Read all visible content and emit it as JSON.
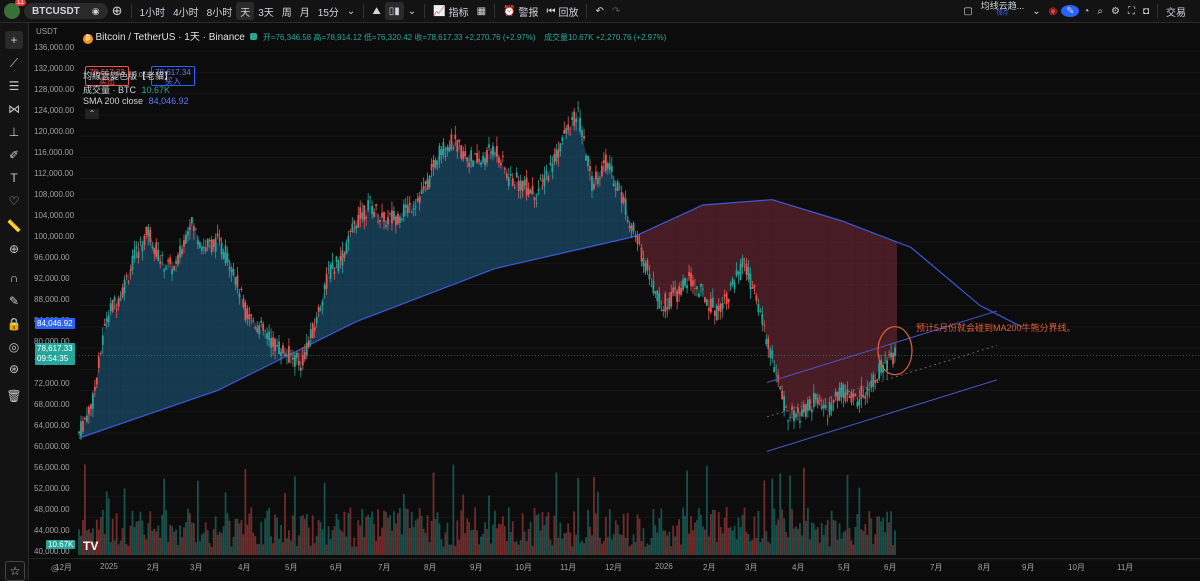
{
  "toolbar": {
    "badge": "11",
    "symbol": "BTCUSDT",
    "intervals": [
      "1小时",
      "4小时",
      "8小时",
      "天",
      "3天",
      "周",
      "月",
      "15分"
    ],
    "active_interval": "天",
    "indicators": "指标",
    "alert": "警报",
    "replay": "回放",
    "indicator_name": "均线云趋...",
    "indicator_sub": "保存",
    "trade": "交易"
  },
  "axis_header": "USDT",
  "legend": {
    "title": "Bitcoin / TetherUS · 1天 · Binance",
    "ohlc": "开=76,346.58 高=78,914.12 低=76,320.42 收=78,617.33 +2,270.76 (+2.97%)",
    "volume_line": "成交量10.67K +2,270.76 (+2.97%)",
    "sell_price": "78,617.33",
    "sell_label": "卖出",
    "spread": "0.01",
    "buy_price": "78,617.34",
    "buy_label": "买入",
    "indicator1": "均線雲變色版【老貓】",
    "indicator2_label": "成交量 · BTC",
    "indicator2_value": "10.67K",
    "indicator3_label": "SMA 200 close",
    "indicator3_value": "84,046.92"
  },
  "price_scale": [
    "136,000.00",
    "132,000.00",
    "128,000.00",
    "124,000.00",
    "120,000.00",
    "116,000.00",
    "112,000.00",
    "108,000.00",
    "104,000.00",
    "100,000.00",
    "96,000.00",
    "92,000.00",
    "88,000.00",
    "84,000.00",
    "80,000.00",
    "76,000.00",
    "72,000.00",
    "68,000.00",
    "64,000.00",
    "60,000.00",
    "56,000.00",
    "52,000.00",
    "48,000.00",
    "44,000.00",
    "40,000.00"
  ],
  "sma_tag": "84,046.92",
  "last_price_tag": "78,617.33",
  "countdown": "09:54:35",
  "volume_tag": "10.67K",
  "time_scale": [
    "12月",
    "2025",
    "2月",
    "3月",
    "4月",
    "5月",
    "6月",
    "7月",
    "8月",
    "9月",
    "10月",
    "11月",
    "12月",
    "2026",
    "2月",
    "3月",
    "4月",
    "5月",
    "6月",
    "7月",
    "8月",
    "9月",
    "10月",
    "11月"
  ],
  "annotation": "预计5月份就会碰到MA200牛熊分界线。",
  "colors": {
    "up": "#26a69a",
    "down": "#ef5350",
    "sma": "#3b5bdb",
    "cloud_bull": "#1e5f86",
    "cloud_bear": "#7a2a3a",
    "annotation": "#e0603a"
  },
  "chart_data": {
    "type": "candlestick",
    "title": "Bitcoin / TetherUS · 1天 · Binance",
    "ylim": [
      40000,
      137000
    ],
    "close_path": [
      [
        0,
        64000
      ],
      [
        1,
        70000
      ],
      [
        2,
        86000
      ],
      [
        3,
        90000
      ],
      [
        4,
        97000
      ],
      [
        5,
        102000
      ],
      [
        6,
        96000
      ],
      [
        7,
        95000
      ],
      [
        8,
        104000
      ],
      [
        9,
        99000
      ],
      [
        10,
        100000
      ],
      [
        11,
        96000
      ],
      [
        12,
        87000
      ],
      [
        13,
        84000
      ],
      [
        14,
        81000
      ],
      [
        15,
        79000
      ],
      [
        16,
        77000
      ],
      [
        17,
        84000
      ],
      [
        18,
        94000
      ],
      [
        19,
        97000
      ],
      [
        20,
        104000
      ],
      [
        21,
        107000
      ],
      [
        22,
        104000
      ],
      [
        23,
        105000
      ],
      [
        24,
        107000
      ],
      [
        25,
        110000
      ],
      [
        26,
        117000
      ],
      [
        27,
        119000
      ],
      [
        28,
        116000
      ],
      [
        29,
        115000
      ],
      [
        30,
        118000
      ],
      [
        31,
        112000
      ],
      [
        32,
        111000
      ],
      [
        33,
        109000
      ],
      [
        34,
        114000
      ],
      [
        35,
        120000
      ],
      [
        36,
        124000
      ],
      [
        37,
        111000
      ],
      [
        38,
        115000
      ],
      [
        39,
        110000
      ],
      [
        40,
        102000
      ],
      [
        41,
        95000
      ],
      [
        42,
        88000
      ],
      [
        43,
        90000
      ],
      [
        44,
        93000
      ],
      [
        45,
        90000
      ],
      [
        46,
        87000
      ],
      [
        47,
        91000
      ],
      [
        48,
        96000
      ],
      [
        49,
        88000
      ],
      [
        50,
        78000
      ],
      [
        51,
        68000
      ],
      [
        52,
        67000
      ],
      [
        53,
        70000
      ],
      [
        54,
        68000
      ],
      [
        55,
        72000
      ],
      [
        56,
        70000
      ],
      [
        57,
        73000
      ],
      [
        58,
        77000
      ],
      [
        59,
        78600
      ]
    ],
    "sma200": [
      [
        0,
        63000
      ],
      [
        10,
        72000
      ],
      [
        20,
        85000
      ],
      [
        30,
        95000
      ],
      [
        40,
        101000
      ],
      [
        45,
        107000
      ],
      [
        50,
        108000
      ],
      [
        55,
        104000
      ],
      [
        60,
        99000
      ],
      [
        65,
        88000
      ],
      [
        68,
        84000
      ]
    ],
    "volume_last": "10.67K"
  }
}
